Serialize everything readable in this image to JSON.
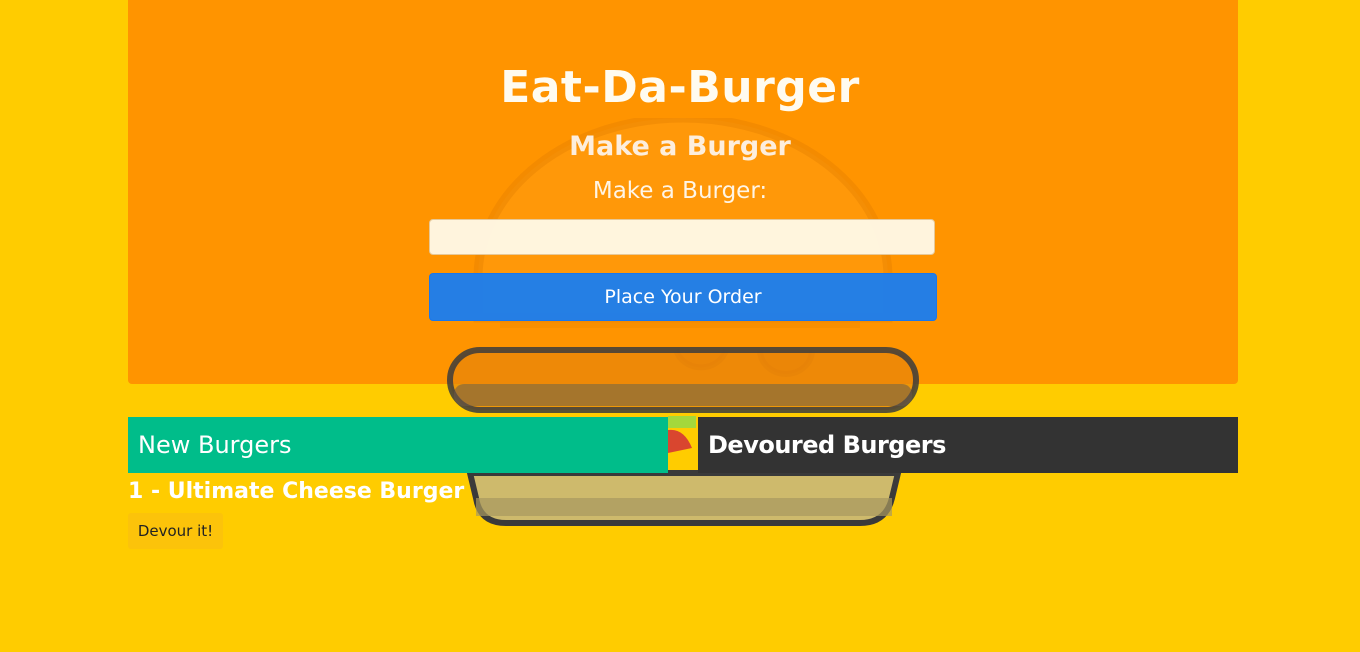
{
  "header": {
    "title": "Eat-Da-Burger",
    "subtitle": "Make a Burger"
  },
  "form": {
    "label": "Make a Burger:",
    "input_value": "",
    "input_placeholder": "",
    "submit_label": "Place Your Order"
  },
  "panels": {
    "new_burgers_title": "New Burgers",
    "devoured_burgers_title": "Devoured Burgers"
  },
  "new_burgers": [
    {
      "label": "1 - Ultimate Cheese Burger",
      "button_label": "Devour it!"
    }
  ],
  "colors": {
    "page_background": "#ffcc00",
    "jumbotron": "#ff9400",
    "primary_button": "#147df5",
    "new_panel": "#00bd8a",
    "devoured_panel": "#333333",
    "devour_button": "#fcc30a"
  },
  "icons": {
    "background_illustration": "burger-icon"
  }
}
